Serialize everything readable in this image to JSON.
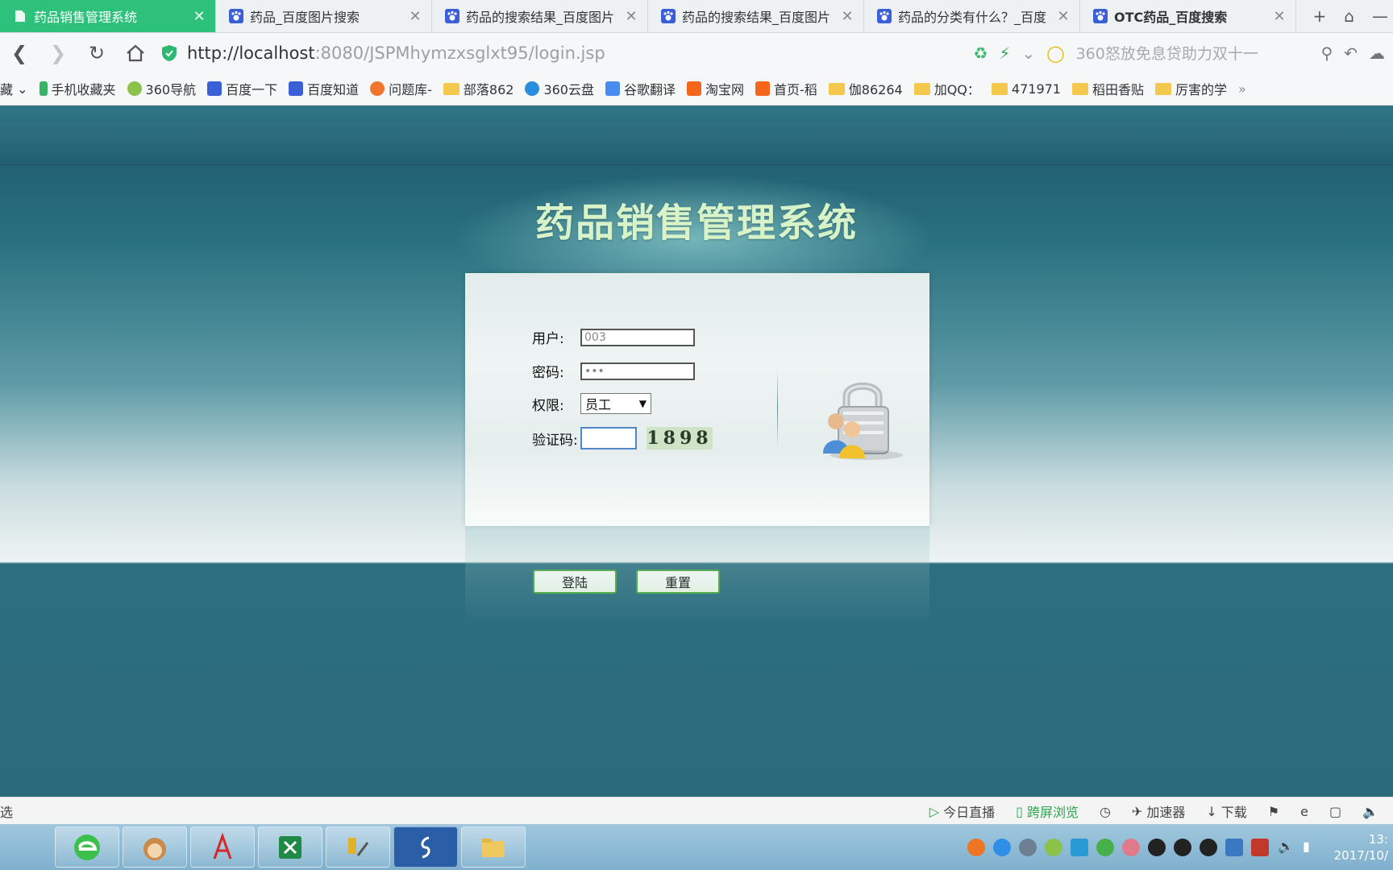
{
  "browser": {
    "tabs": [
      {
        "title": "药品销售管理系统",
        "active": true
      },
      {
        "title": "药品_百度图片搜索",
        "active": false
      },
      {
        "title": "药品的搜索结果_百度图片",
        "active": false
      },
      {
        "title": "药品的搜索结果_百度图片",
        "active": false
      },
      {
        "title": "药品的分类有什么？_百度",
        "active": false
      },
      {
        "title": "OTC药品_百度搜索",
        "active": false
      }
    ],
    "url_host": "http://localhost",
    "url_rest": ":8080/JSPMhymzxsglxt95/login.jsp",
    "search_hint": "360怒放免息贷助力双十一",
    "bookmarks": {
      "cut_label": "藏",
      "items": [
        "手机收藏夹",
        "360导航",
        "百度一下",
        "百度知道",
        "问题库-",
        "部落862",
        "360云盘",
        "谷歌翻译",
        "淘宝网",
        "首页-稻",
        "伽86264",
        "加QQ：",
        "471971",
        "稻田香贴",
        "厉害的学"
      ],
      "more": "»"
    }
  },
  "page": {
    "title": "药品销售管理系统",
    "login": {
      "user_label": "用户:",
      "user_value": "003",
      "password_label": "密码:",
      "password_value": "•••",
      "role_label": "权限:",
      "role_value": "员工",
      "captcha_label": "验证码:",
      "captcha_code": "1898",
      "login_button": "登陆",
      "reset_button": "重置"
    }
  },
  "statusbar": {
    "left": "选",
    "items": [
      "今日直播",
      "跨屏浏览",
      "加速器",
      "下载"
    ]
  },
  "taskbar": {
    "clock_time": "13:",
    "clock_date": "2017/10/"
  },
  "colors": {
    "active_tab": "#2ec17b",
    "page_bg": "#2c6f80",
    "title_text": "#d9f3c8",
    "button_border": "#47a83a"
  }
}
